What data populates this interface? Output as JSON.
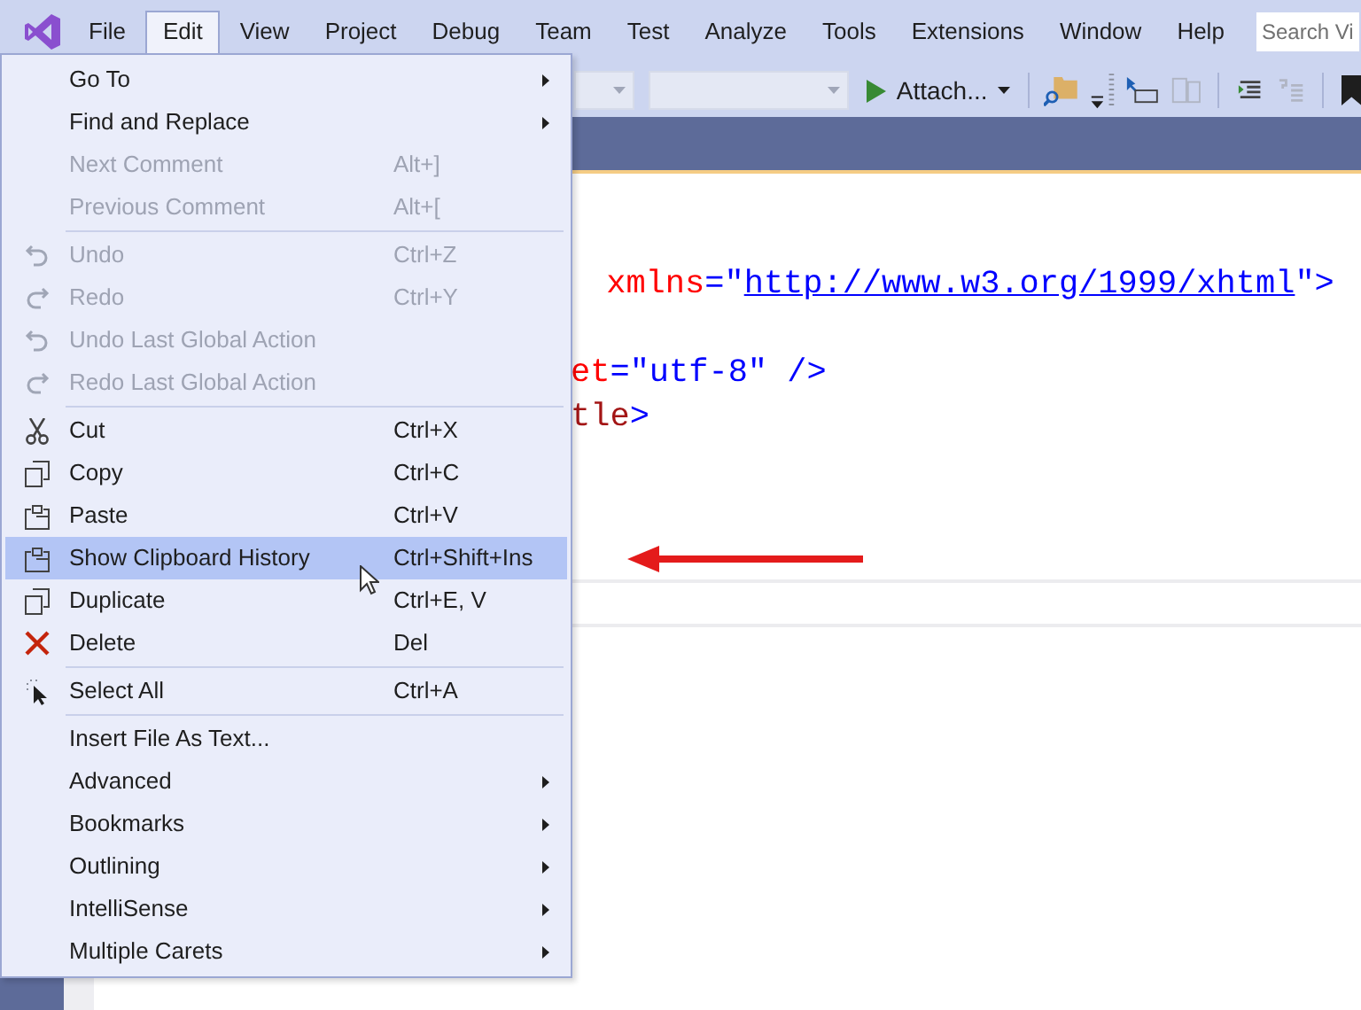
{
  "menubar": {
    "items": [
      {
        "label": "File",
        "selected": false
      },
      {
        "label": "Edit",
        "selected": true
      },
      {
        "label": "View",
        "selected": false
      },
      {
        "label": "Project",
        "selected": false
      },
      {
        "label": "Debug",
        "selected": false
      },
      {
        "label": "Team",
        "selected": false
      },
      {
        "label": "Test",
        "selected": false
      },
      {
        "label": "Analyze",
        "selected": false
      },
      {
        "label": "Tools",
        "selected": false
      },
      {
        "label": "Extensions",
        "selected": false
      },
      {
        "label": "Window",
        "selected": false
      },
      {
        "label": "Help",
        "selected": false
      }
    ],
    "search": {
      "placeholder": "Search Vi"
    }
  },
  "toolbar": {
    "attach_button": "Attach..."
  },
  "editor": {
    "lines": [
      {
        "kind": "code",
        "tokens": [
          {
            "kind": "attr",
            "text": " xmlns"
          },
          {
            "kind": "punct",
            "text": "=\""
          },
          {
            "kind": "url",
            "text": "http://www.w3.org/1999/xhtml"
          },
          {
            "kind": "punct",
            "text": "\">"
          }
        ]
      },
      {
        "kind": "blank"
      },
      {
        "kind": "code",
        "tokens": [
          {
            "kind": "attr",
            "text": "et"
          },
          {
            "kind": "punct",
            "text": "=\"utf-8\" />"
          }
        ]
      },
      {
        "kind": "code",
        "tokens": [
          {
            "kind": "tag",
            "text": "tle"
          },
          {
            "kind": "punct",
            "text": ">"
          }
        ]
      }
    ]
  },
  "edit_menu": {
    "items": [
      {
        "kind": "item",
        "label": "Go To",
        "submenu": true,
        "disabled": false,
        "selected": false
      },
      {
        "kind": "item",
        "label": "Find and Replace",
        "submenu": true,
        "disabled": false,
        "selected": false
      },
      {
        "kind": "item",
        "label": "Next Comment",
        "shortcut": "Alt+]",
        "disabled": true,
        "selected": false
      },
      {
        "kind": "item",
        "label": "Previous Comment",
        "shortcut": "Alt+[",
        "disabled": true,
        "selected": false
      },
      {
        "kind": "separator"
      },
      {
        "kind": "item",
        "label": "Undo",
        "shortcut": "Ctrl+Z",
        "disabled": true,
        "selected": false
      },
      {
        "kind": "item",
        "label": "Redo",
        "shortcut": "Ctrl+Y",
        "disabled": true,
        "selected": false
      },
      {
        "kind": "item",
        "label": "Undo Last Global Action",
        "disabled": true,
        "selected": false
      },
      {
        "kind": "item",
        "label": "Redo Last Global Action",
        "disabled": true,
        "selected": false
      },
      {
        "kind": "separator"
      },
      {
        "kind": "item",
        "label": "Cut",
        "shortcut": "Ctrl+X",
        "disabled": false,
        "selected": false
      },
      {
        "kind": "item",
        "label": "Copy",
        "shortcut": "Ctrl+C",
        "disabled": false,
        "selected": false
      },
      {
        "kind": "item",
        "label": "Paste",
        "shortcut": "Ctrl+V",
        "disabled": false,
        "selected": false
      },
      {
        "kind": "item",
        "label": "Show Clipboard History",
        "shortcut": "Ctrl+Shift+Ins",
        "disabled": false,
        "selected": true
      },
      {
        "kind": "item",
        "label": "Duplicate",
        "shortcut": "Ctrl+E, V",
        "disabled": false,
        "selected": false
      },
      {
        "kind": "item",
        "label": "Delete",
        "shortcut": "Del",
        "disabled": false,
        "selected": false
      },
      {
        "kind": "separator"
      },
      {
        "kind": "item",
        "label": "Select All",
        "shortcut": "Ctrl+A",
        "disabled": false,
        "selected": false
      },
      {
        "kind": "separator"
      },
      {
        "kind": "item",
        "label": "Insert File As Text...",
        "disabled": false,
        "selected": false
      },
      {
        "kind": "item",
        "label": "Advanced",
        "submenu": true,
        "disabled": false,
        "selected": false
      },
      {
        "kind": "item",
        "label": "Bookmarks",
        "submenu": true,
        "disabled": false,
        "selected": false
      },
      {
        "kind": "item",
        "label": "Outlining",
        "submenu": true,
        "disabled": false,
        "selected": false
      },
      {
        "kind": "item",
        "label": "IntelliSense",
        "submenu": true,
        "disabled": false,
        "selected": false
      },
      {
        "kind": "item",
        "label": "Multiple Carets",
        "submenu": true,
        "disabled": false,
        "selected": false
      }
    ]
  }
}
